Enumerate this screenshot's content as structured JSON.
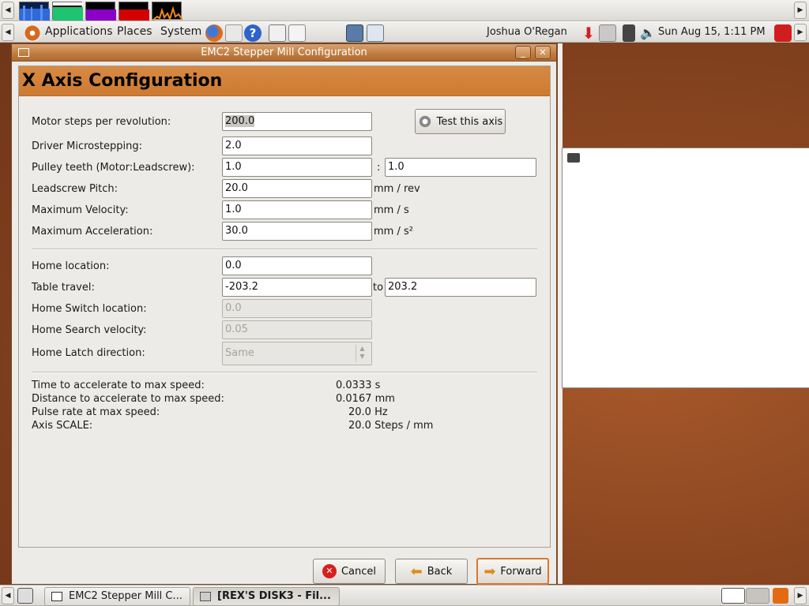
{
  "top_panel": {
    "applications": "Applications",
    "places": "Places",
    "system": "System",
    "user": "Joshua O'Regan",
    "clock": "Sun Aug 15,  1:11 PM"
  },
  "dialog": {
    "title": "EMC2 Stepper Mill Configuration",
    "header": "X Axis Configuration",
    "fields": {
      "motor_steps_label": "Motor steps per revolution:",
      "motor_steps_value": "200.0",
      "test_axis_button": "Test this axis",
      "microstepping_label": "Driver Microstepping:",
      "microstepping_value": "2.0",
      "pulley_label": "Pulley teeth (Motor:Leadscrew):",
      "pulley_motor_value": "1.0",
      "pulley_sep": ":",
      "pulley_leadscrew_value": "1.0",
      "pitch_label": "Leadscrew Pitch:",
      "pitch_value": "20.0",
      "pitch_unit": "mm / rev",
      "max_velocity_label": "Maximum Velocity:",
      "max_velocity_value": "1.0",
      "max_velocity_unit": "mm / s",
      "max_accel_label": "Maximum Acceleration:",
      "max_accel_value": "30.0",
      "max_accel_unit": "mm / s²",
      "home_location_label": "Home location:",
      "home_location_value": "0.0",
      "table_travel_label": "Table travel:",
      "table_travel_min": "-203.2",
      "table_travel_to": "to",
      "table_travel_max": "203.2",
      "home_switch_label": "Home Switch location:",
      "home_switch_value": "0.0",
      "home_search_label": "Home Search velocity:",
      "home_search_value": "0.05",
      "home_latch_label": "Home Latch direction:",
      "home_latch_value": "Same"
    },
    "results": [
      {
        "label": "Time to accelerate to max speed:",
        "value": "0.0333 s"
      },
      {
        "label": "Distance to accelerate to max speed:",
        "value": "0.0167 mm"
      },
      {
        "label": "Pulse rate at max speed:",
        "value": "20.0 Hz"
      },
      {
        "label": "Axis SCALE:",
        "value": "20.0 Steps / mm"
      }
    ],
    "buttons": {
      "cancel": "Cancel",
      "back": "Back",
      "forward": "Forward"
    }
  },
  "taskbar": {
    "items": [
      {
        "label": "EMC2 Stepper Mill C..."
      },
      {
        "label": "[REX'S DISK3 - Fil..."
      }
    ]
  },
  "colors": {
    "accent": "#cd7a32",
    "titlebar": "#c07c40"
  }
}
